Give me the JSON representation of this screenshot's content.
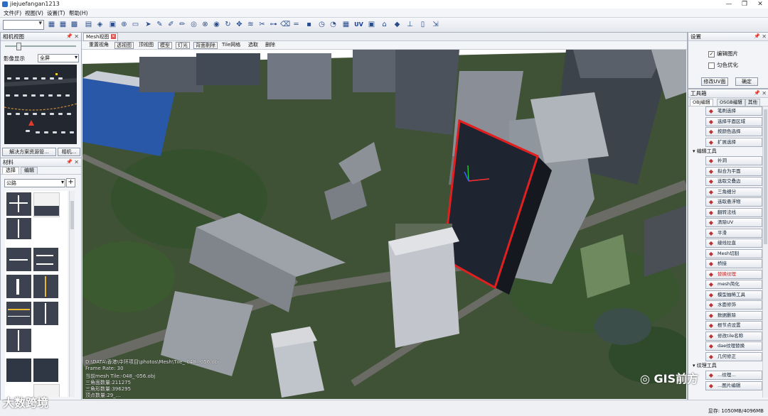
{
  "window": {
    "title": "jiejuefangan1213",
    "controls": [
      "—",
      "❐",
      "✕"
    ]
  },
  "menu": [
    "文件(F)",
    "视图(V)",
    "设置(T)",
    "帮助(H)"
  ],
  "toolbar": {
    "uv_label": "UV"
  },
  "left_panel": {
    "title": "相机视图",
    "display_label": "影像显示",
    "display_value": "全屏",
    "btn_solution": "解决方案资源管...",
    "btn_camera": "相机..."
  },
  "material_panel": {
    "title": "材料",
    "tabs": [
      "选择",
      "编辑"
    ],
    "category": "公路",
    "add_label": "+"
  },
  "viewport": {
    "tab_label": "Mesh视图",
    "close": "✕",
    "view_buttons": [
      "重置视角",
      "透视图",
      "顶视图",
      "模型",
      "灯光",
      "背面剔除",
      "Tile网格",
      "选取",
      "删除"
    ],
    "overlay_lines": [
      "D:\\DATA\\香港\\中环项目\\photos\\Mesh\\Tile_-048_-056.obj",
      "Frame Rate: 30",
      "当前mesh Tile:-048_-056.obj",
      "三角面数量:211275",
      "三角形数量:396295",
      "顶点数量:29_..."
    ]
  },
  "settings_panel": {
    "title": "设置",
    "chk_edit_image": "编辑图片",
    "chk_edit_image_checked": true,
    "chk_uniform": "匀色优化",
    "chk_uniform_checked": false,
    "btn_modify_uv": "修改UV面",
    "btn_confirm": "确定"
  },
  "toolbox": {
    "title": "工具箱",
    "tabs": [
      "OBJ编辑",
      "OSGB编辑",
      "其他"
    ],
    "items": [
      {
        "type": "tool",
        "label": "笔刷选择",
        "icon": "brush"
      },
      {
        "type": "tool",
        "label": "选择平面区域",
        "icon": "region"
      },
      {
        "type": "tool",
        "label": "按颜色选择",
        "icon": "color"
      },
      {
        "type": "tool",
        "label": "扩展选择",
        "icon": "expand"
      },
      {
        "type": "cat",
        "label": "编辑工具"
      },
      {
        "type": "tool",
        "label": "补洞",
        "icon": "hole"
      },
      {
        "type": "tool",
        "label": "拟合为平面",
        "icon": "plane"
      },
      {
        "type": "tool",
        "label": "选取交叠边",
        "icon": "edge"
      },
      {
        "type": "tool",
        "label": "三角细分",
        "icon": "subdiv"
      },
      {
        "type": "tool",
        "label": "选取悬浮物",
        "icon": "float"
      },
      {
        "type": "tool",
        "label": "翻转法线",
        "icon": "flip"
      },
      {
        "type": "tool",
        "label": "清除UV",
        "icon": "clear"
      },
      {
        "type": "tool",
        "label": "平滑",
        "icon": "smooth"
      },
      {
        "type": "tool",
        "label": "缝线拉直",
        "icon": "seam"
      },
      {
        "type": "tool",
        "label": "Mesh切割",
        "icon": "cut"
      },
      {
        "type": "tool",
        "label": "桥接",
        "icon": "bridge"
      },
      {
        "type": "tool",
        "label": "替换纹理",
        "icon": "texture",
        "red": true
      },
      {
        "type": "tool",
        "label": "mesh简化",
        "icon": "simplify"
      },
      {
        "type": "tool",
        "label": "模型抽稀工具",
        "icon": "decimate"
      },
      {
        "type": "tool",
        "label": "水面修饰",
        "icon": "water"
      },
      {
        "type": "tool",
        "label": "数据删除",
        "icon": "delete"
      },
      {
        "type": "tool",
        "label": "根节点设置",
        "icon": "root"
      },
      {
        "type": "tool",
        "label": "修改tile名称",
        "icon": "rename"
      },
      {
        "type": "tool",
        "label": "dae纹理替换",
        "icon": "dae"
      },
      {
        "type": "tool",
        "label": "几何修正",
        "icon": "geom"
      },
      {
        "type": "cat",
        "label": "纹理工具"
      },
      {
        "type": "tool",
        "label": "...纹理...",
        "icon": "tex2"
      },
      {
        "type": "tool",
        "label": "...图片编辑",
        "icon": "img"
      }
    ]
  },
  "status": {
    "memory": "显存: 1050MB/4096MB"
  },
  "watermarks": {
    "bottom_left": "大数跨境",
    "bottom_right": "GIS前方"
  },
  "colors": {
    "selection": "#e02020",
    "accent": "#2b6cc4"
  }
}
